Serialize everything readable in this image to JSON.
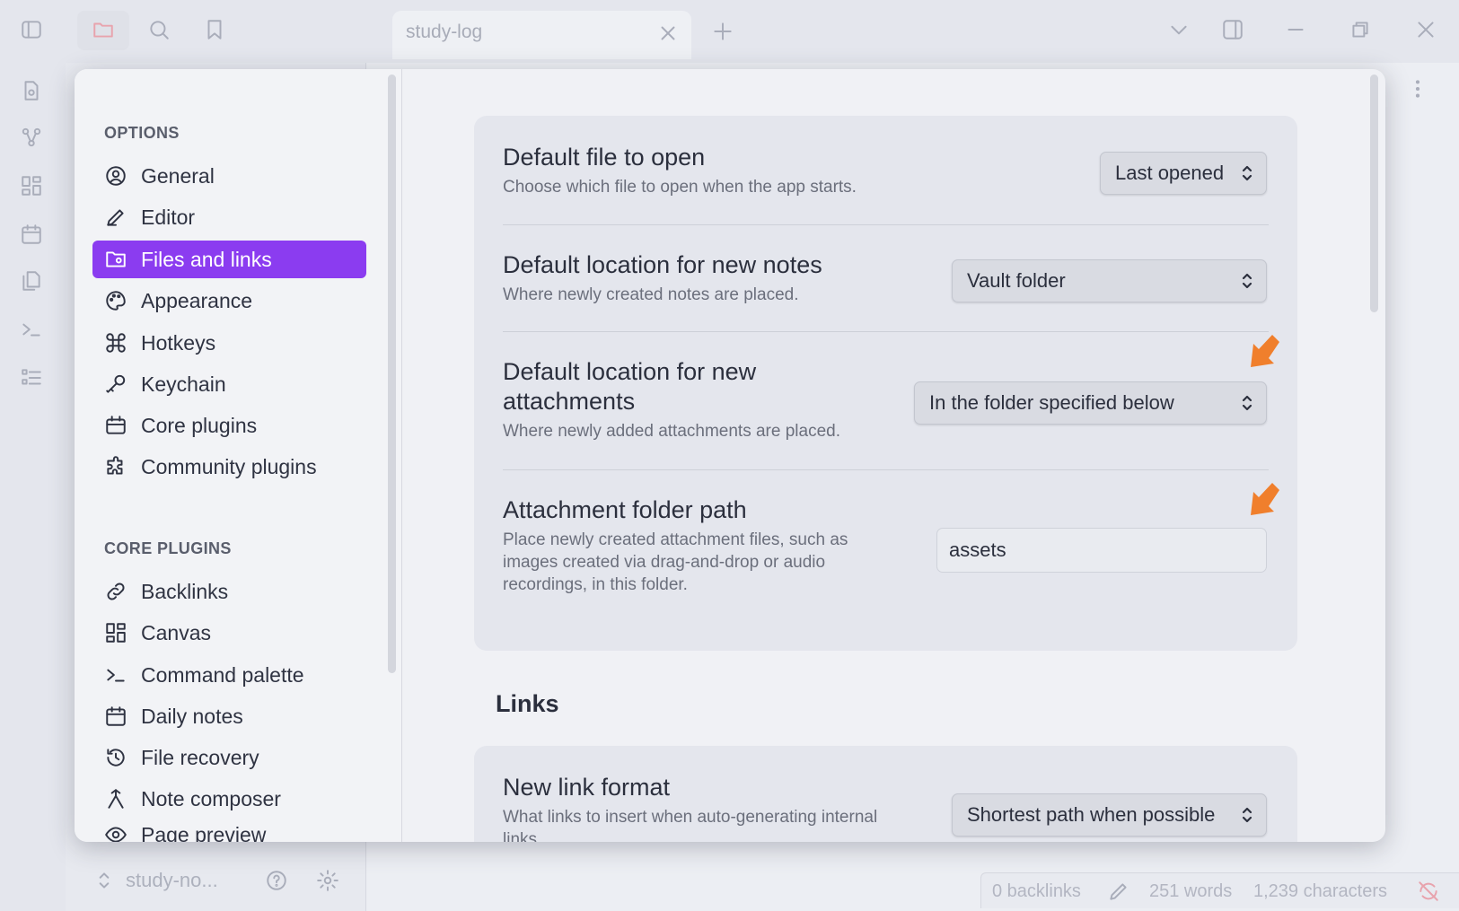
{
  "window": {
    "tab_title": "study-log",
    "vault_name": "study-no...",
    "status": {
      "backlinks": "0 backlinks",
      "words": "251 words",
      "characters": "1,239 characters"
    }
  },
  "sidebar": {
    "options_heading": "OPTIONS",
    "options": [
      {
        "label": "General",
        "icon": "user-circle-icon"
      },
      {
        "label": "Editor",
        "icon": "pencil-icon"
      },
      {
        "label": "Files and links",
        "icon": "folder-cog-icon",
        "active": true
      },
      {
        "label": "Appearance",
        "icon": "palette-icon"
      },
      {
        "label": "Hotkeys",
        "icon": "command-icon"
      },
      {
        "label": "Keychain",
        "icon": "key-icon"
      },
      {
        "label": "Core plugins",
        "icon": "calendar-box-icon"
      },
      {
        "label": "Community plugins",
        "icon": "puzzle-icon"
      }
    ],
    "core_plugins_heading": "CORE PLUGINS",
    "core_plugins": [
      {
        "label": "Backlinks",
        "icon": "backlink-icon"
      },
      {
        "label": "Canvas",
        "icon": "grid-icon"
      },
      {
        "label": "Command palette",
        "icon": "terminal-icon"
      },
      {
        "label": "Daily notes",
        "icon": "calendar-icon"
      },
      {
        "label": "File recovery",
        "icon": "history-icon"
      },
      {
        "label": "Note composer",
        "icon": "merge-icon"
      },
      {
        "label": "Page preview",
        "icon": "preview-icon"
      }
    ]
  },
  "settings": {
    "default_file": {
      "name": "Default file to open",
      "desc": "Choose which file to open when the app starts.",
      "value": "Last opened"
    },
    "new_note_location": {
      "name": "Default location for new notes",
      "desc": "Where newly created notes are placed.",
      "value": "Vault folder"
    },
    "attachment_location": {
      "name_line1": "Default location for new",
      "name_line2": "attachments",
      "desc": "Where newly added attachments are placed.",
      "value": "In the folder specified below"
    },
    "attachment_path": {
      "name": "Attachment folder path",
      "desc_line1": "Place newly created attachment files, such as",
      "desc_line2": "images created via drag-and-drop or audio",
      "desc_line3": "recordings, in this folder.",
      "value": "assets"
    },
    "links_heading": "Links",
    "new_link_format": {
      "name": "New link format",
      "desc": "What links to insert when auto-generating internal links.",
      "value": "Shortest path when possible"
    }
  },
  "colors": {
    "accent": "#8b3cf0",
    "marker": "#f07f2c"
  }
}
